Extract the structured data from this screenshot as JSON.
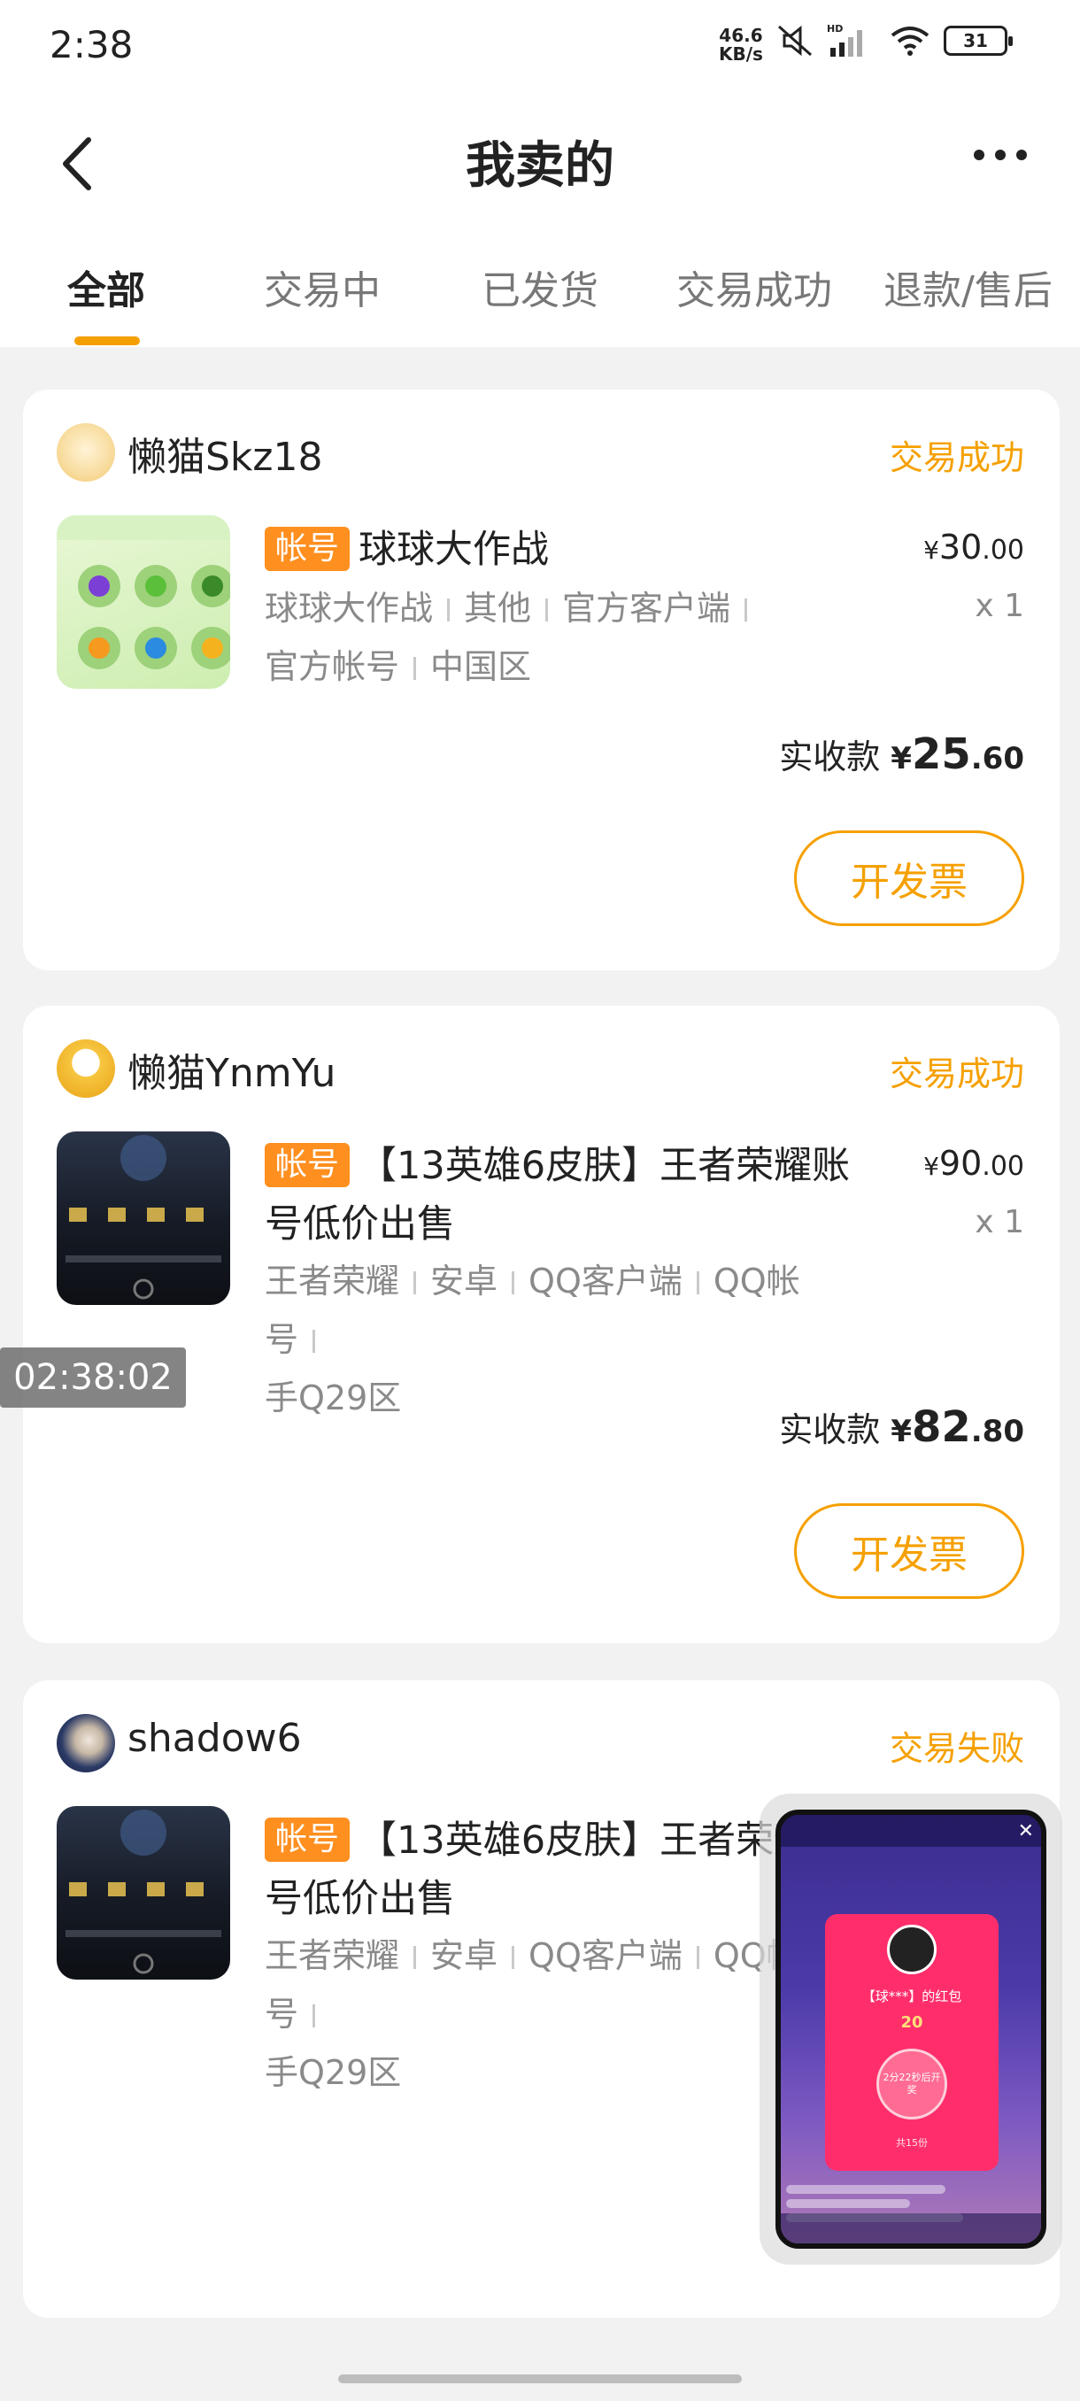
{
  "status_bar": {
    "time": "2:38",
    "net_speed_value": "46.6",
    "net_speed_unit": "KB/s",
    "battery": "31",
    "icons": [
      "mute-icon",
      "signal-icon",
      "wifi-icon",
      "battery-icon"
    ]
  },
  "header": {
    "title": "我卖的",
    "back_icon": "chevron-left-icon",
    "more_icon": "more-dots-icon"
  },
  "tabs": [
    {
      "label": "全部",
      "active": true
    },
    {
      "label": "交易中",
      "active": false
    },
    {
      "label": "已发货",
      "active": false
    },
    {
      "label": "交易成功",
      "active": false
    },
    {
      "label": "退款/售后",
      "active": false
    }
  ],
  "orders": [
    {
      "seller": "懒猫Skz18",
      "status": "交易成功",
      "tag": "帐号",
      "title": "球球大作战",
      "attrs_line1": [
        "球球大作战",
        "其他",
        "官方客户端"
      ],
      "attrs_line2": [
        "官方帐号",
        "中国区"
      ],
      "price_currency": "¥",
      "price_int": "30",
      "price_dec": ".00",
      "qty": "x 1",
      "received_label": "实收款",
      "received_currency": "¥",
      "received_int": "25",
      "received_dec": ".60",
      "button": "开发票"
    },
    {
      "seller": "懒猫YnmYu",
      "status": "交易成功",
      "tag": "帐号",
      "title": "【13英雄6皮肤】王者荣耀账号低价出售",
      "attrs_line1": [
        "王者荣耀",
        "安卓",
        "QQ客户端",
        "QQ帐号"
      ],
      "attrs_line2": [
        "手Q29区"
      ],
      "price_currency": "¥",
      "price_int": "90",
      "price_dec": ".00",
      "qty": "x 1",
      "received_label": "实收款",
      "received_currency": "¥",
      "received_int": "82",
      "received_dec": ".80",
      "button": "开发票"
    },
    {
      "seller": "shadow6",
      "status": "交易失败",
      "tag": "帐号",
      "title": "【13英雄6皮肤】王者荣耀账号低价出售",
      "attrs_line1": [
        "王者荣耀",
        "安卓",
        "QQ客户端",
        "QQ帐号"
      ],
      "attrs_line2": [
        "手Q29区"
      ]
    }
  ],
  "timestamp_overlay": "02:38:02",
  "pip": {
    "red_packet_title": "【球***】的红包",
    "red_packet_amount": "20",
    "red_packet_button": "2分22秒后开奖",
    "red_packet_footer": "共15份"
  },
  "colors": {
    "accent": "#f5a000",
    "tag_bg": "#ff8f1f",
    "background": "#f2f2f2"
  }
}
